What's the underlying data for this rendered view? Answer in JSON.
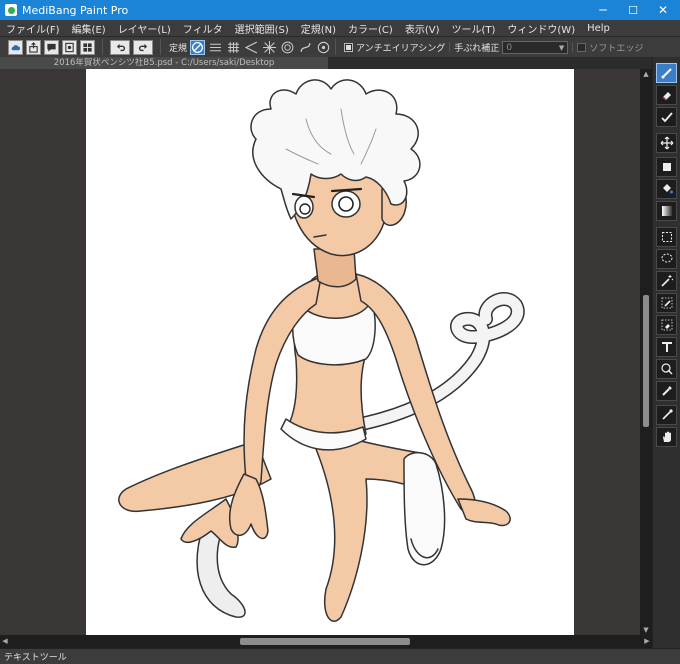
{
  "window": {
    "title": "MediBang Paint Pro",
    "controls": {
      "minimize": "─",
      "maximize": "☐",
      "close": "✕"
    }
  },
  "menu": [
    "ファイル(F)",
    "編集(E)",
    "レイヤー(L)",
    "フィルタ",
    "選択範囲(S)",
    "定規(N)",
    "カラー(C)",
    "表示(V)",
    "ツール(T)",
    "ウィンドウ(W)",
    "Help"
  ],
  "toolbar": {
    "ruler_label": "定規",
    "antialias_label": "アンチエイリアシング",
    "stabilizer_label": "手ぶれ補正",
    "stabilizer_value": "0",
    "soft_edge_label": "ソフトエッジ"
  },
  "document": {
    "tab_title": "2016年賀状ペンシツ社B5.psd - C:/Users/saki/Desktop"
  },
  "status": {
    "tool_name": "テキストツール"
  },
  "colors": {
    "titlebar": "#1c84d6",
    "chrome": "#3c3c3c",
    "canvas_bg": "#3b3636",
    "active_tool": "#3a7dc8"
  },
  "tools": [
    "brush-icon",
    "eraser-icon",
    "dot-icon",
    "move-icon",
    "fill-rect-icon",
    "bucket-icon",
    "gradient-icon",
    "select-rect-icon",
    "lasso-icon",
    "magic-wand-icon",
    "select-pen-icon",
    "select-eraser-icon",
    "text-icon",
    "operation-icon",
    "eyedropper-icon",
    "dropper-icon",
    "hand-icon"
  ]
}
